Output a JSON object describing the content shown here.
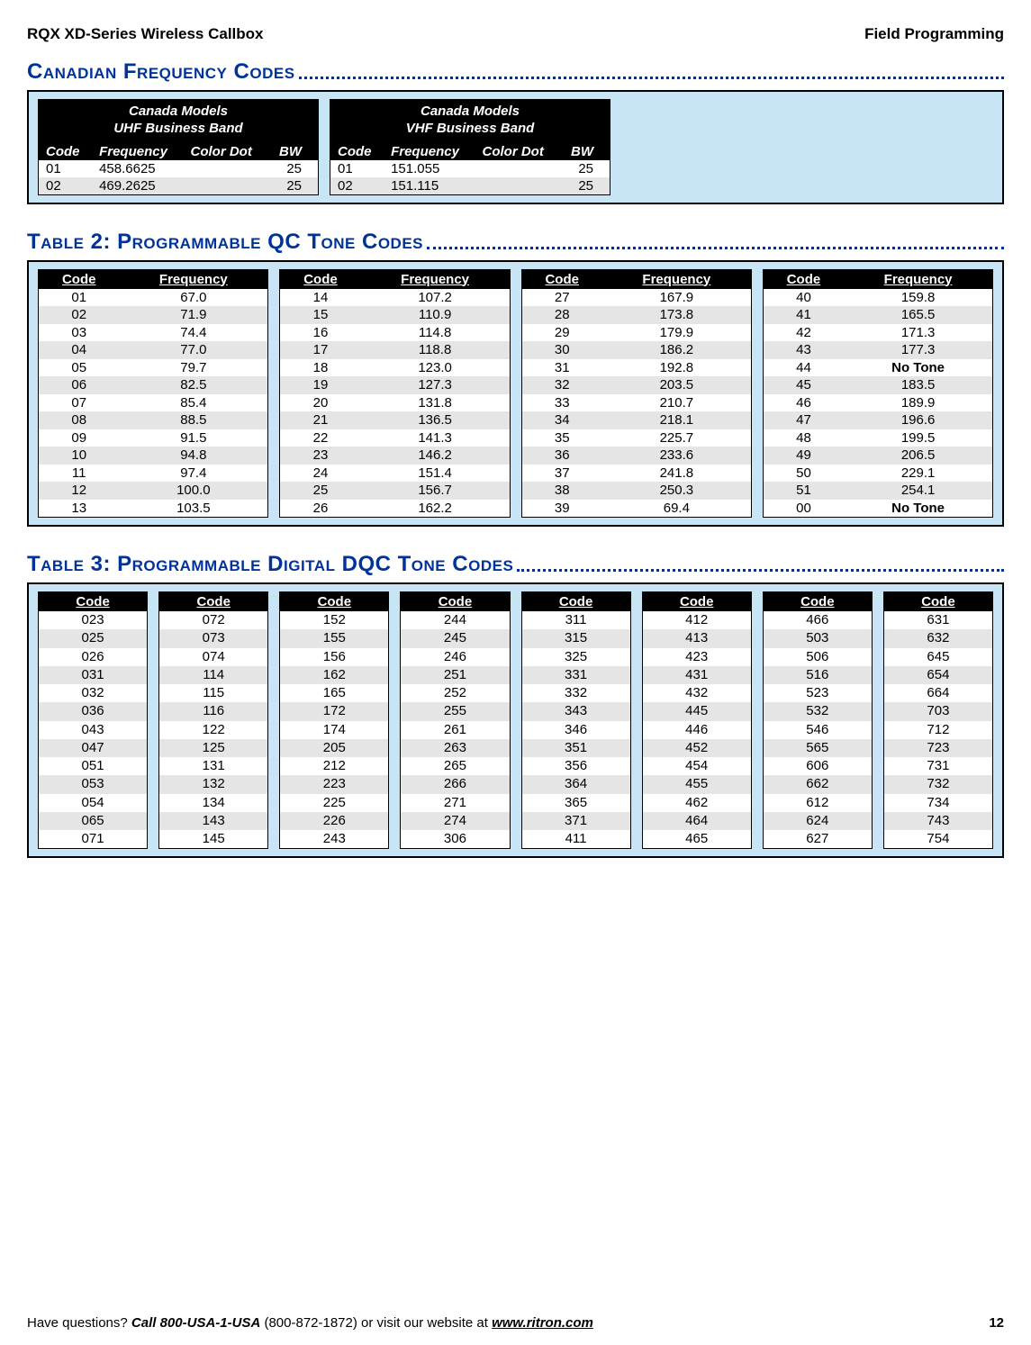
{
  "header": {
    "left": "RQX XD-Series Wireless Callbox",
    "right": "Field Programming"
  },
  "section1": {
    "heading": "Canadian Frequency Codes",
    "tables": [
      {
        "title1": "Canada Models",
        "title2": "UHF Business Band",
        "cols": [
          "Code",
          "Frequency",
          "Color Dot",
          "BW"
        ],
        "rows": [
          {
            "code": "01",
            "freq": "458.6625",
            "dot": "",
            "bw": "25"
          },
          {
            "code": "02",
            "freq": "469.2625",
            "dot": "",
            "bw": "25"
          }
        ]
      },
      {
        "title1": "Canada Models",
        "title2": "VHF Business Band",
        "cols": [
          "Code",
          "Frequency",
          "Color Dot",
          "BW"
        ],
        "rows": [
          {
            "code": "01",
            "freq": "151.055",
            "dot": "",
            "bw": "25"
          },
          {
            "code": "02",
            "freq": "151.115",
            "dot": "",
            "bw": "25"
          }
        ]
      }
    ]
  },
  "section2": {
    "heading": "Table 2: Programmable QC Tone Codes",
    "cols": [
      "Code",
      "Frequency"
    ],
    "groups": [
      [
        {
          "code": "01",
          "freq": "67.0"
        },
        {
          "code": "02",
          "freq": "71.9"
        },
        {
          "code": "03",
          "freq": "74.4"
        },
        {
          "code": "04",
          "freq": "77.0"
        },
        {
          "code": "05",
          "freq": "79.7"
        },
        {
          "code": "06",
          "freq": "82.5"
        },
        {
          "code": "07",
          "freq": "85.4"
        },
        {
          "code": "08",
          "freq": "88.5"
        },
        {
          "code": "09",
          "freq": "91.5"
        },
        {
          "code": "10",
          "freq": "94.8"
        },
        {
          "code": "11",
          "freq": "97.4"
        },
        {
          "code": "12",
          "freq": "100.0"
        },
        {
          "code": "13",
          "freq": "103.5"
        }
      ],
      [
        {
          "code": "14",
          "freq": "107.2"
        },
        {
          "code": "15",
          "freq": "110.9"
        },
        {
          "code": "16",
          "freq": "114.8"
        },
        {
          "code": "17",
          "freq": "118.8"
        },
        {
          "code": "18",
          "freq": "123.0"
        },
        {
          "code": "19",
          "freq": "127.3"
        },
        {
          "code": "20",
          "freq": "131.8"
        },
        {
          "code": "21",
          "freq": "136.5"
        },
        {
          "code": "22",
          "freq": "141.3"
        },
        {
          "code": "23",
          "freq": "146.2"
        },
        {
          "code": "24",
          "freq": "151.4"
        },
        {
          "code": "25",
          "freq": "156.7"
        },
        {
          "code": "26",
          "freq": "162.2"
        }
      ],
      [
        {
          "code": "27",
          "freq": "167.9"
        },
        {
          "code": "28",
          "freq": "173.8"
        },
        {
          "code": "29",
          "freq": "179.9"
        },
        {
          "code": "30",
          "freq": "186.2"
        },
        {
          "code": "31",
          "freq": "192.8"
        },
        {
          "code": "32",
          "freq": "203.5"
        },
        {
          "code": "33",
          "freq": "210.7"
        },
        {
          "code": "34",
          "freq": "218.1"
        },
        {
          "code": "35",
          "freq": "225.7"
        },
        {
          "code": "36",
          "freq": "233.6"
        },
        {
          "code": "37",
          "freq": "241.8"
        },
        {
          "code": "38",
          "freq": "250.3"
        },
        {
          "code": "39",
          "freq": "69.4"
        }
      ],
      [
        {
          "code": "40",
          "freq": "159.8"
        },
        {
          "code": "41",
          "freq": "165.5"
        },
        {
          "code": "42",
          "freq": "171.3"
        },
        {
          "code": "43",
          "freq": "177.3"
        },
        {
          "code": "44",
          "freq": "No Tone",
          "bold": true
        },
        {
          "code": "45",
          "freq": "183.5"
        },
        {
          "code": "46",
          "freq": "189.9"
        },
        {
          "code": "47",
          "freq": "196.6"
        },
        {
          "code": "48",
          "freq": "199.5"
        },
        {
          "code": "49",
          "freq": "206.5"
        },
        {
          "code": "50",
          "freq": "229.1"
        },
        {
          "code": "51",
          "freq": "254.1"
        },
        {
          "code": "00",
          "freq": "No Tone",
          "bold": true
        }
      ]
    ]
  },
  "section3": {
    "heading": "Table 3: Programmable Digital DQC Tone Codes",
    "col": "Code",
    "groups": [
      [
        "023",
        "025",
        "026",
        "031",
        "032",
        "036",
        "043",
        "047",
        "051",
        "053",
        "054",
        "065",
        "071"
      ],
      [
        "072",
        "073",
        "074",
        "114",
        "115",
        "116",
        "122",
        "125",
        "131",
        "132",
        "134",
        "143",
        "145"
      ],
      [
        "152",
        "155",
        "156",
        "162",
        "165",
        "172",
        "174",
        "205",
        "212",
        "223",
        "225",
        "226",
        "243"
      ],
      [
        "244",
        "245",
        "246",
        "251",
        "252",
        "255",
        "261",
        "263",
        "265",
        "266",
        "271",
        "274",
        "306"
      ],
      [
        "311",
        "315",
        "325",
        "331",
        "332",
        "343",
        "346",
        "351",
        "356",
        "364",
        "365",
        "371",
        "411"
      ],
      [
        "412",
        "413",
        "423",
        "431",
        "432",
        "445",
        "446",
        "452",
        "454",
        "455",
        "462",
        "464",
        "465"
      ],
      [
        "466",
        "503",
        "506",
        "516",
        "523",
        "532",
        "546",
        "565",
        "606",
        "662",
        "612",
        "624",
        "627"
      ],
      [
        "631",
        "632",
        "645",
        "654",
        "664",
        "703",
        "712",
        "723",
        "731",
        "732",
        "734",
        "743",
        "754"
      ]
    ]
  },
  "footer": {
    "q": "Have questions?  ",
    "call_label": "Call 800-USA-1-USA",
    "call_num": " (800-872-1872) or visit our website at ",
    "site": "www.ritron.com",
    "page": "12"
  }
}
